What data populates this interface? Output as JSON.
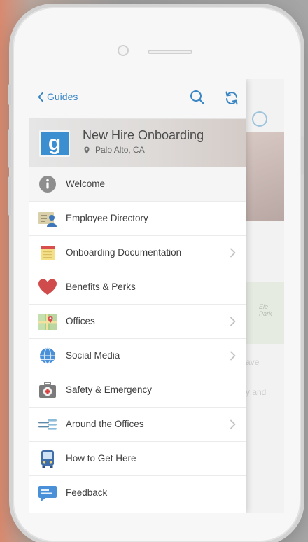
{
  "topbar": {
    "back_label": "Guides"
  },
  "guide": {
    "logo_letter": "g",
    "title": "New Hire Onboarding",
    "location": "Palo Alto, CA"
  },
  "menu": {
    "items": [
      {
        "label": "Welcome",
        "icon": "info-icon",
        "has_chevron": false
      },
      {
        "label": "Employee Directory",
        "icon": "contact-card-icon",
        "has_chevron": false
      },
      {
        "label": "Onboarding Documentation",
        "icon": "notepad-icon",
        "has_chevron": true
      },
      {
        "label": "Benefits & Perks",
        "icon": "heart-icon",
        "has_chevron": false
      },
      {
        "label": "Offices",
        "icon": "map-icon",
        "has_chevron": true
      },
      {
        "label": "Social Media",
        "icon": "globe-icon",
        "has_chevron": true
      },
      {
        "label": "Safety & Emergency",
        "icon": "first-aid-kit-icon",
        "has_chevron": false
      },
      {
        "label": "Around the Offices",
        "icon": "dining-icon",
        "has_chevron": true
      },
      {
        "label": "How to Get Here",
        "icon": "bus-icon",
        "has_chevron": false
      },
      {
        "label": "Feedback",
        "icon": "chat-bubble-icon",
        "has_chevron": false
      }
    ]
  },
  "background_app": {
    "map_label": "Ele\nPark",
    "text_fragment_1": "ave",
    "text_fragment_2": "y and"
  },
  "colors": {
    "accent": "#3a86c5",
    "logo_bg": "#3b8fd0",
    "heart": "#d04b4b"
  }
}
